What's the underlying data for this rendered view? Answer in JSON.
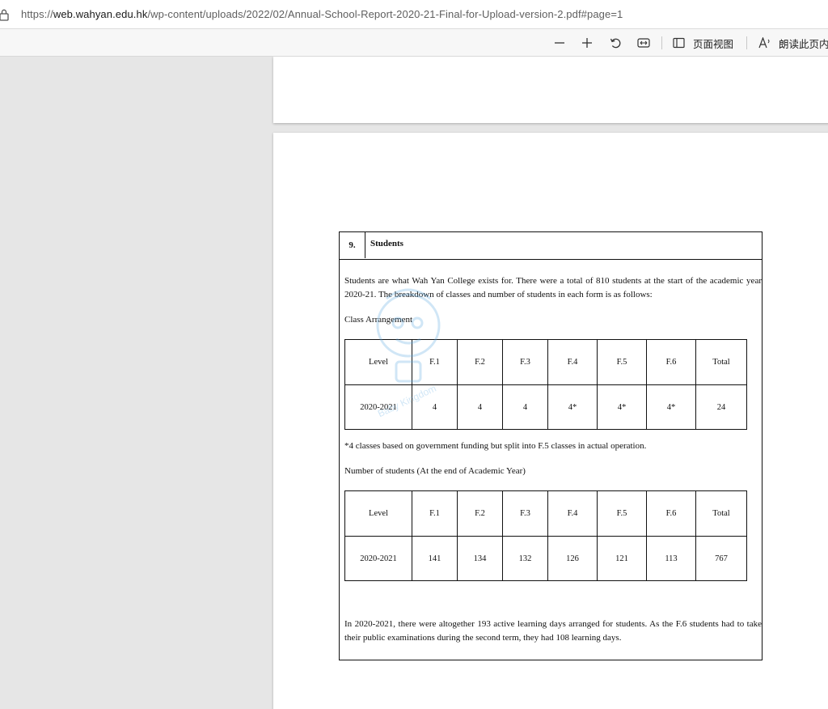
{
  "browser": {
    "url_prefix": "https://",
    "url_domain": "web.wahyan.edu.hk",
    "url_path": "/wp-content/uploads/2022/02/Annual-School-Report-2020-21-Final-for-Upload-version-2.pdf#page=1"
  },
  "toolbar": {
    "page_view_label": "页面视图",
    "read_aloud_label": "朗读此页内"
  },
  "section": {
    "number": "9.",
    "title": "Students",
    "intro": "Students are what Wah Yan College exists for. There were a total of 810 students at the start of the academic year 2020-21. The breakdown of classes and number of students in each form is as follows:",
    "class_caption": "Class Arrangement",
    "class_table": {
      "headers": [
        "Level",
        "F.1",
        "F.2",
        "F.3",
        "F.4",
        "F.5",
        "F.6",
        "Total"
      ],
      "row": [
        "2020-2021",
        "4",
        "4",
        "4",
        "4*",
        "4*",
        "4*",
        "24"
      ]
    },
    "footnote": "*4 classes based on government funding but split into F.5 classes in actual operation.",
    "students_caption": "Number of students (At the end of Academic Year)",
    "students_table": {
      "headers": [
        "Level",
        "F.1",
        "F.2",
        "F.3",
        "F.4",
        "F.5",
        "F.6",
        "Total"
      ],
      "row": [
        "2020-2021",
        "141",
        "134",
        "132",
        "126",
        "121",
        "113",
        "767"
      ]
    },
    "closing": "In 2020-2021, there were altogether 193 active learning days arranged for students. As the F.6 students had to take their public examinations during the second term, they had 108 learning days."
  },
  "watermark": {
    "text": "Baby Kingdom",
    "color": "#5aa7e0"
  }
}
